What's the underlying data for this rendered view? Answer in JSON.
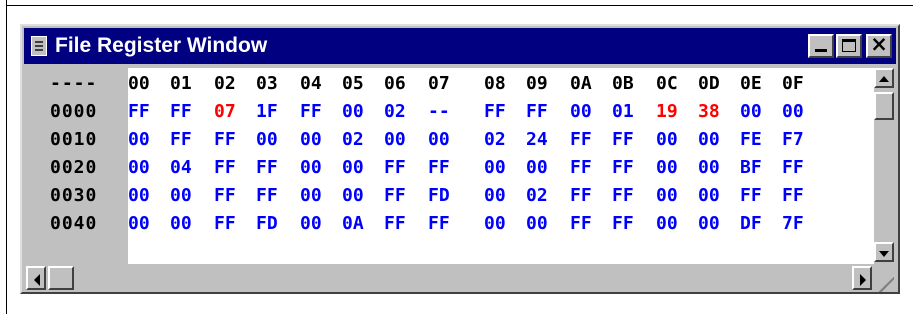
{
  "window": {
    "title": "File Register Window",
    "close_glyph": "×"
  },
  "header_label": "----",
  "header": [
    "00",
    "01",
    "02",
    "03",
    "04",
    "05",
    "06",
    "07",
    "08",
    "09",
    "0A",
    "0B",
    "0C",
    "0D",
    "0E",
    "0F"
  ],
  "rows": [
    {
      "addr": "0000",
      "values": [
        "FF",
        "FF",
        "07",
        "1F",
        "FF",
        "00",
        "02",
        "--",
        "FF",
        "FF",
        "00",
        "01",
        "19",
        "38",
        "00",
        "00"
      ],
      "highlight": [
        2,
        12,
        13
      ]
    },
    {
      "addr": "0010",
      "values": [
        "00",
        "FF",
        "FF",
        "00",
        "00",
        "02",
        "00",
        "00",
        "02",
        "24",
        "FF",
        "FF",
        "00",
        "00",
        "FE",
        "F7"
      ],
      "highlight": []
    },
    {
      "addr": "0020",
      "values": [
        "00",
        "04",
        "FF",
        "FF",
        "00",
        "00",
        "FF",
        "FF",
        "00",
        "00",
        "FF",
        "FF",
        "00",
        "00",
        "BF",
        "FF"
      ],
      "highlight": []
    },
    {
      "addr": "0030",
      "values": [
        "00",
        "00",
        "FF",
        "FF",
        "00",
        "00",
        "FF",
        "FD",
        "00",
        "02",
        "FF",
        "FF",
        "00",
        "00",
        "FF",
        "FF"
      ],
      "highlight": []
    },
    {
      "addr": "0040",
      "values": [
        "00",
        "00",
        "FF",
        "FD",
        "00",
        "0A",
        "FF",
        "FF",
        "00",
        "00",
        "FF",
        "FF",
        "00",
        "00",
        "DF",
        "7F"
      ],
      "highlight": []
    }
  ],
  "colors": {
    "title_bar": "#000080",
    "value": "#0000ff",
    "changed_value": "#ff0000",
    "address": "#000000",
    "face": "#c0c0c0"
  },
  "icons": {
    "app": "register-window-icon",
    "minimize": "minimize-icon",
    "maximize": "maximize-icon",
    "close": "close-icon",
    "scroll_up": "arrow-up-icon",
    "scroll_down": "arrow-down-icon",
    "scroll_left": "arrow-left-icon",
    "scroll_right": "arrow-right-icon",
    "resize": "resize-grip-icon"
  }
}
